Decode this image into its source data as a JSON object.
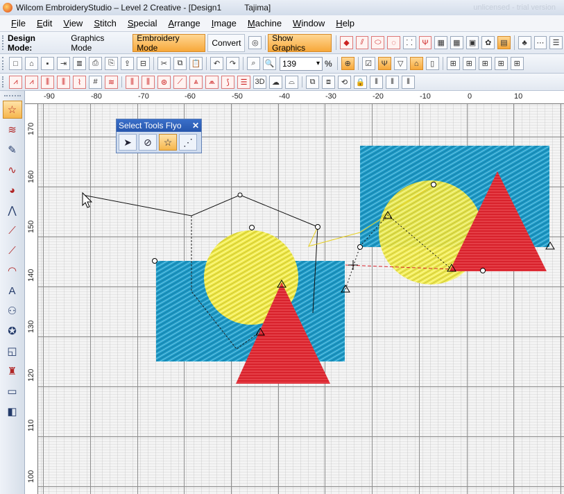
{
  "window": {
    "title": "Wilcom EmbroideryStudio – Level 2 Creative - [Design1          Tajima]",
    "ghost_title": "unlicensed - trial version"
  },
  "menu": [
    "File",
    "Edit",
    "View",
    "Stitch",
    "Special",
    "Arrange",
    "Image",
    "Machine",
    "Window",
    "Help"
  ],
  "toolbar": {
    "design_mode_label": "Design Mode:",
    "graphics_mode": "Graphics Mode",
    "embroidery_mode": "Embroidery Mode",
    "convert": "Convert",
    "show_graphics": "Show Graphics",
    "zoom_value": "139",
    "zoom_unit": "%"
  },
  "flyout": {
    "title": "Select Tools Flyo",
    "close": "✕",
    "tools": [
      "select-object-icon",
      "select-by-color-icon",
      "select-tool-icon",
      "polygon-select-icon"
    ]
  },
  "ruler": {
    "horizontal": [
      "-90",
      "-80",
      "-70",
      "-60",
      "-50",
      "-40",
      "-30",
      "-20",
      "-10",
      "0",
      "10"
    ],
    "vertical": [
      "170",
      "160",
      "150",
      "140",
      "130",
      "120",
      "110",
      "100"
    ]
  },
  "colors": {
    "fill_blue": "#1e9cc8",
    "fill_yellow": "#f0ea4a",
    "fill_red": "#d8222c",
    "accent_orange": "#f7a83a",
    "title_blue": "#2656ad"
  },
  "toolbox": [
    "select-tool-icon",
    "reshape-stitch-icon",
    "digitize-pen-icon",
    "freehand-icon",
    "color-wheel-icon",
    "reshape-nodes-icon",
    "line-tool-icon",
    "polyline-tool-icon",
    "arc-tool-icon",
    "lettering-icon",
    "people-icon",
    "monogram-icon",
    "frame-icon",
    "applique-icon",
    "rectangle-icon",
    "split-icon"
  ]
}
